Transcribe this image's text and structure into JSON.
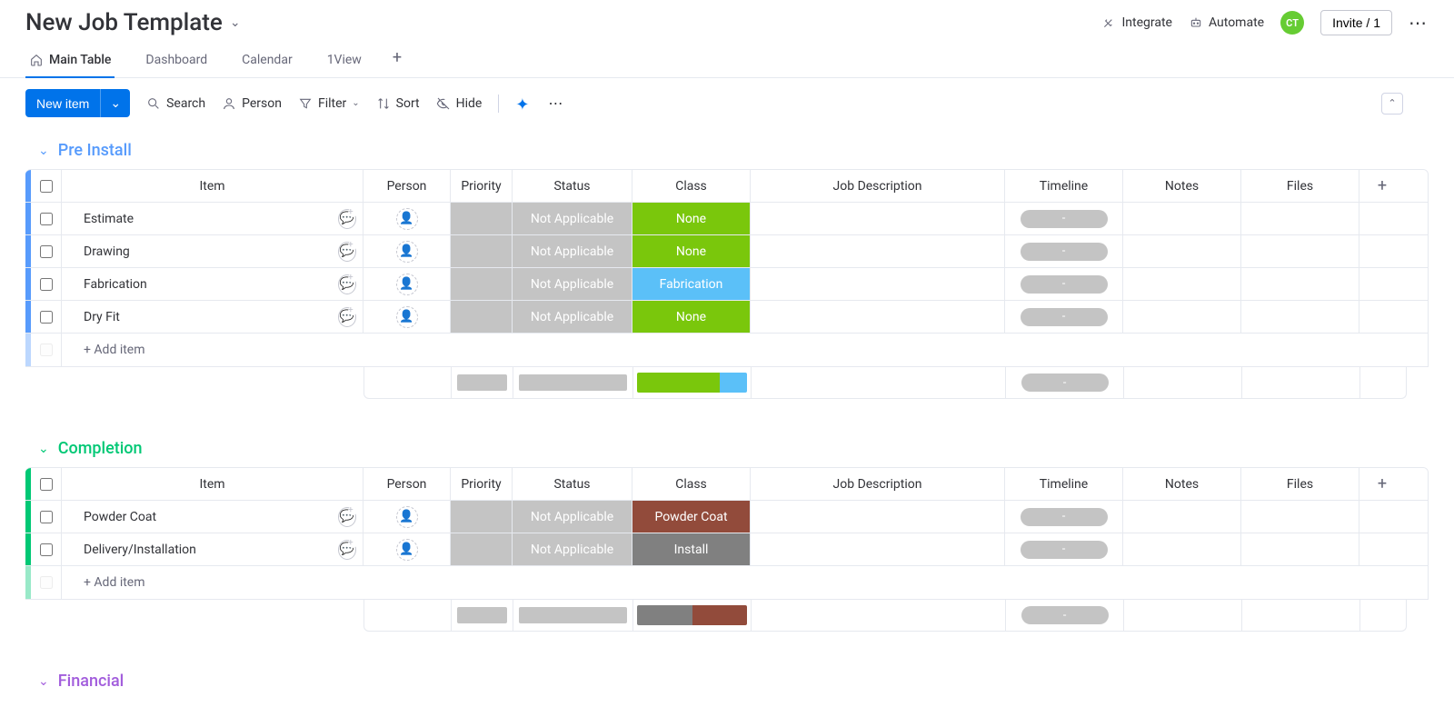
{
  "header": {
    "title": "New Job Template",
    "integrate": "Integrate",
    "automate": "Automate",
    "avatar_initials": "CT",
    "invite": "Invite / 1"
  },
  "tabs": [
    {
      "label": "Main Table",
      "active": true,
      "icon": "home"
    },
    {
      "label": "Dashboard",
      "active": false
    },
    {
      "label": "Calendar",
      "active": false
    },
    {
      "label": "1View",
      "active": false
    }
  ],
  "toolbar": {
    "new_item": "New item",
    "search": "Search",
    "person": "Person",
    "filter": "Filter",
    "sort": "Sort",
    "hide": "Hide"
  },
  "columns": {
    "item": "Item",
    "person": "Person",
    "priority": "Priority",
    "status": "Status",
    "class": "Class",
    "job_description": "Job Description",
    "timeline": "Timeline",
    "notes": "Notes",
    "files": "Files"
  },
  "timeline_placeholder": "-",
  "add_item_label": "+ Add item",
  "colors": {
    "green": "#7ac70c",
    "blue_light": "#5bc0f8",
    "grey": "#c4c4c4",
    "brown": "#924b3b",
    "dark_grey": "#808080",
    "group_blue": "#579bfc",
    "group_green": "#00c875",
    "group_purple": "#a25ddc"
  },
  "groups": [
    {
      "id": "pre_install",
      "title": "Pre Install",
      "color": "#579bfc",
      "rows": [
        {
          "name": "Estimate",
          "status": "Not Applicable",
          "class_label": "None",
          "class_color": "#7ac70c"
        },
        {
          "name": "Drawing",
          "status": "Not Applicable",
          "class_label": "None",
          "class_color": "#7ac70c"
        },
        {
          "name": "Fabrication",
          "status": "Not Applicable",
          "class_label": "Fabrication",
          "class_color": "#5bc0f8"
        },
        {
          "name": "Dry Fit",
          "status": "Not Applicable",
          "class_label": "None",
          "class_color": "#7ac70c"
        }
      ],
      "summary_class": [
        {
          "color": "#7ac70c",
          "pct": 75
        },
        {
          "color": "#5bc0f8",
          "pct": 25
        }
      ]
    },
    {
      "id": "completion",
      "title": "Completion",
      "color": "#00c875",
      "rows": [
        {
          "name": "Powder Coat",
          "status": "Not Applicable",
          "class_label": "Powder Coat",
          "class_color": "#924b3b"
        },
        {
          "name": "Delivery/Installation",
          "status": "Not Applicable",
          "class_label": "Install",
          "class_color": "#808080"
        }
      ],
      "summary_class": [
        {
          "color": "#808080",
          "pct": 50
        },
        {
          "color": "#924b3b",
          "pct": 50
        }
      ]
    },
    {
      "id": "financial",
      "title": "Financial",
      "color": "#a25ddc",
      "collapsed": true
    }
  ]
}
